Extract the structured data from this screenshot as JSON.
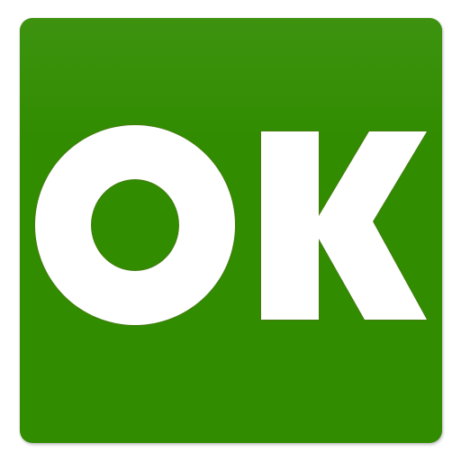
{
  "icon": {
    "label": "OK",
    "background_color": "#318c00",
    "glyph_color": "#ffffff",
    "glyph_outline_color": "#8a6a5a"
  }
}
